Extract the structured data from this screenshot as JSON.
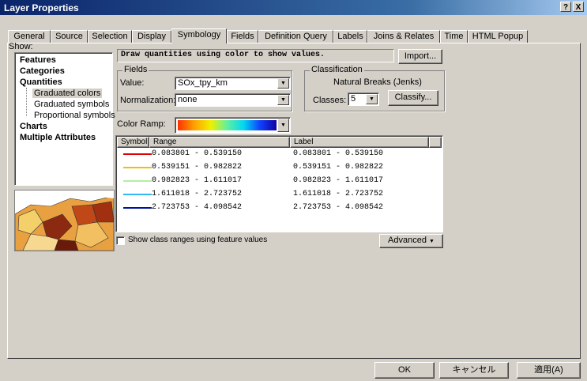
{
  "window": {
    "title": "Layer Properties",
    "help_btn": "?",
    "close_btn": "X"
  },
  "tabs": [
    {
      "label": "General"
    },
    {
      "label": "Source"
    },
    {
      "label": "Selection"
    },
    {
      "label": "Display"
    },
    {
      "label": "Symbology"
    },
    {
      "label": "Fields"
    },
    {
      "label": "Definition Query"
    },
    {
      "label": "Labels"
    },
    {
      "label": "Joins & Relates"
    },
    {
      "label": "Time"
    },
    {
      "label": "HTML Popup"
    }
  ],
  "show": {
    "label": "Show:",
    "tree": [
      {
        "label": "Features",
        "bold": true
      },
      {
        "label": "Categories",
        "bold": true
      },
      {
        "label": "Quantities",
        "bold": true
      },
      {
        "label": "Graduated colors",
        "bold": false,
        "selected": true
      },
      {
        "label": "Graduated symbols",
        "bold": false
      },
      {
        "label": "Proportional symbols",
        "bold": false
      },
      {
        "label": "Charts",
        "bold": true
      },
      {
        "label": "Multiple Attributes",
        "bold": true
      }
    ]
  },
  "header": {
    "description": "Draw quantities using color to show values.",
    "import_btn": "Import..."
  },
  "fields": {
    "caption": "Fields",
    "value_label": "Value:",
    "value": "SOx_tpy_km",
    "normalization_label": "Normalization:",
    "normalization": "none"
  },
  "classification": {
    "caption": "Classification",
    "method": "Natural Breaks (Jenks)",
    "classes_label": "Classes:",
    "classes_value": "5",
    "classify_btn": "Classify..."
  },
  "color_ramp": {
    "label": "Color Ramp:",
    "colors": [
      "#ff3000",
      "#ffa000",
      "#f0f000",
      "#60f0a0",
      "#00d8f0",
      "#1040ff",
      "#1000a0"
    ]
  },
  "table": {
    "headers": {
      "symbol": "Symbol",
      "range": "Range",
      "label": "Label"
    },
    "rows": [
      {
        "color": "#e00000",
        "range": "0.083801 - 0.539150",
        "label": "0.083801 - 0.539150"
      },
      {
        "color": "#f0c000",
        "range": "0.539151 - 0.982822",
        "label": "0.539151 - 0.982822"
      },
      {
        "color": "#b0f0a0",
        "range": "0.982823 - 1.611017",
        "label": "0.982823 - 1.611017"
      },
      {
        "color": "#30b8f0",
        "range": "1.611018 - 2.723752",
        "label": "1.611018 - 2.723752"
      },
      {
        "color": "#0010a0",
        "range": "2.723753 - 4.098542",
        "label": "2.723753 - 4.098542"
      }
    ]
  },
  "options": {
    "show_class_ranges": "Show class ranges using feature values",
    "advanced_btn": "Advanced"
  },
  "footer": {
    "ok": "OK",
    "cancel": "キャンセル",
    "apply": "適用(A)"
  }
}
